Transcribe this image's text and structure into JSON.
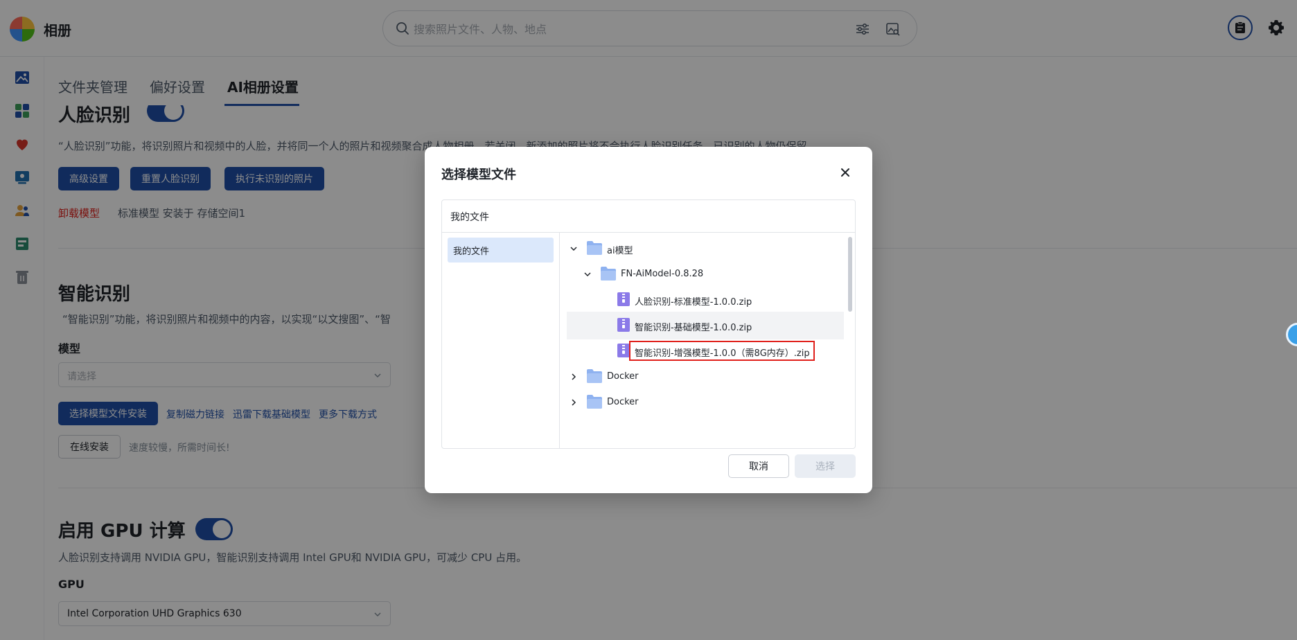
{
  "app": {
    "title": "相册"
  },
  "search": {
    "placeholder": "搜索照片文件、人物、地点"
  },
  "tabs": [
    {
      "label": "文件夹管理"
    },
    {
      "label": "偏好设置"
    },
    {
      "label": "AI相册设置"
    }
  ],
  "face": {
    "title": "人脸识别",
    "desc": "“人脸识别”功能，将识别照片和视频中的人脸，并将同一个人的照片和视频聚合成人物相册。若关闭，新添加的照片将不会执行人脸识别任务，已识别的人物仍保留。",
    "buttons": [
      "高级设置",
      "重置人脸识别",
      "执行未识别的照片"
    ],
    "uninstall": "卸载模型",
    "install_info": "标准模型 安装于 存储空间1"
  },
  "smart": {
    "title": "智能识别",
    "desc": "“智能识别”功能，将识别照片和视频中的内容，以实现“以文搜图”、“智",
    "model_label": "模型",
    "model_placeholder": "请选择",
    "install_button": "选择模型文件安装",
    "links": [
      "复制磁力链接",
      "迅雷下载基础模型",
      "更多下载方式"
    ],
    "online_button": "在线安装",
    "online_hint": "速度较慢，所需时间长!"
  },
  "gpu": {
    "title": "启用 GPU 计算",
    "desc": "人脸识别支持调用 NVIDIA GPU，智能识别支持调用 Intel GPU和 NVIDIA GPU，可减少 CPU 占用。",
    "label": "GPU",
    "value": "Intel Corporation UHD Graphics 630"
  },
  "dialog": {
    "title": "选择模型文件",
    "breadcrumb": "我的文件",
    "side_item": "我的文件",
    "tree": [
      {
        "name": "ai模型",
        "type": "folder",
        "expanded": true
      },
      {
        "name": "FN-AiModel-0.8.28",
        "type": "folder",
        "expanded": true
      },
      {
        "name": "人脸识别-标准模型-1.0.0.zip",
        "type": "zip"
      },
      {
        "name": "智能识别-基础模型-1.0.0.zip",
        "type": "zip"
      },
      {
        "name": "智能识别-增强模型-1.0.0（需8G内存）.zip",
        "type": "zip",
        "selected": true
      },
      {
        "name": "Docker",
        "type": "folder",
        "expanded": false
      },
      {
        "name": "Docker",
        "type": "folder",
        "expanded": false
      }
    ],
    "cancel": "取消",
    "select": "选择"
  },
  "colors": {
    "primary": "#1f4fa8",
    "danger": "#e0201b",
    "folder": "#8fb2f0",
    "zip": "#8b7ae8"
  }
}
